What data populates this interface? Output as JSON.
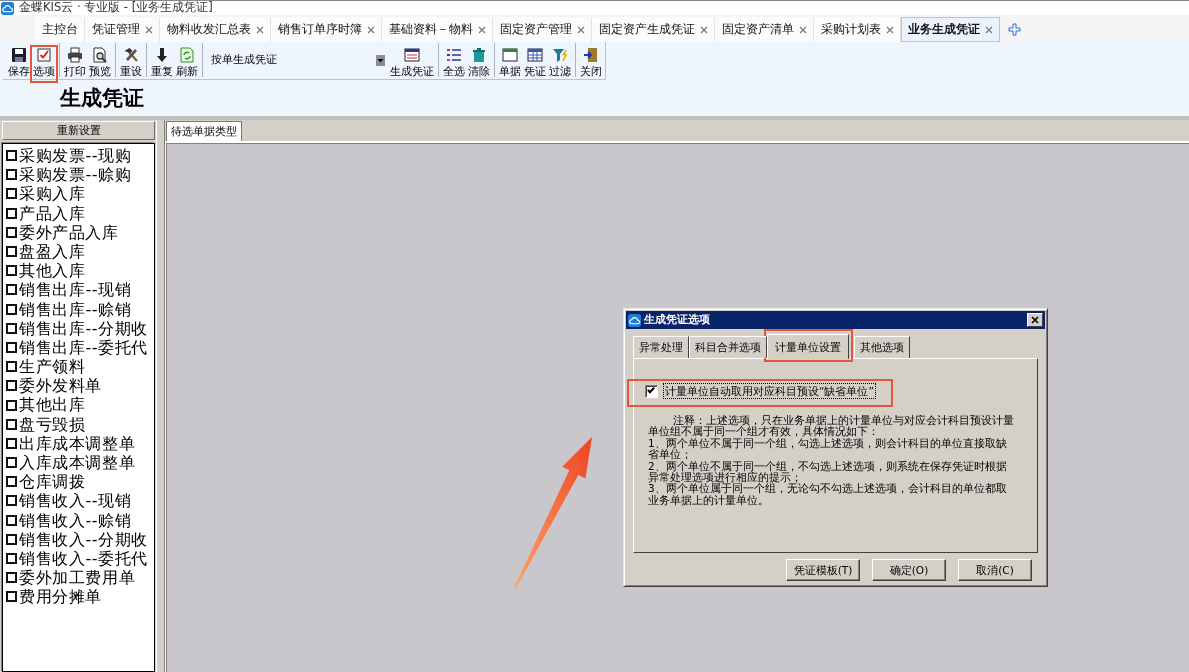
{
  "window": {
    "title": "金蝶KIS云 · 专业版 - [业务生成凭证]"
  },
  "tabs": [
    {
      "label": "主控台",
      "closable": false,
      "selected": false
    },
    {
      "label": "凭证管理",
      "closable": true,
      "selected": false
    },
    {
      "label": "物料收发汇总表",
      "closable": true,
      "selected": false
    },
    {
      "label": "销售订单序时簿",
      "closable": true,
      "selected": false
    },
    {
      "label": "基础资料－物料",
      "closable": true,
      "selected": false
    },
    {
      "label": "固定资产管理",
      "closable": true,
      "selected": false
    },
    {
      "label": "固定资产生成凭证",
      "closable": true,
      "selected": false
    },
    {
      "label": "固定资产清单",
      "closable": true,
      "selected": false
    },
    {
      "label": "采购计划表",
      "closable": true,
      "selected": false
    },
    {
      "label": "业务生成凭证",
      "closable": true,
      "selected": true
    }
  ],
  "toolbar": [
    {
      "kind": "button",
      "label": "保存",
      "highlighted": false
    },
    {
      "kind": "button",
      "label": "选项",
      "highlighted": true
    },
    {
      "kind": "separator"
    },
    {
      "kind": "button",
      "label": "打印",
      "highlighted": false
    },
    {
      "kind": "button",
      "label": "预览",
      "highlighted": false
    },
    {
      "kind": "separator"
    },
    {
      "kind": "button",
      "label": "重设",
      "highlighted": false
    },
    {
      "kind": "separator"
    },
    {
      "kind": "button",
      "label": "重复",
      "highlighted": false
    },
    {
      "kind": "button",
      "label": "刷新",
      "highlighted": false
    },
    {
      "kind": "separator"
    },
    {
      "kind": "dropdown",
      "value": "按单生成凭证"
    },
    {
      "kind": "button",
      "label": "生成凭证",
      "highlighted": false
    },
    {
      "kind": "separator"
    },
    {
      "kind": "button",
      "label": "全选",
      "highlighted": false
    },
    {
      "kind": "button",
      "label": "清除",
      "highlighted": false
    },
    {
      "kind": "separator"
    },
    {
      "kind": "button",
      "label": "单据",
      "highlighted": false
    },
    {
      "kind": "button",
      "label": "凭证",
      "highlighted": false
    },
    {
      "kind": "button",
      "label": "过滤",
      "highlighted": false
    },
    {
      "kind": "separator"
    },
    {
      "kind": "button",
      "label": "关闭",
      "highlighted": false
    }
  ],
  "page_title": "生成凭证",
  "left_panel": {
    "reset_button": "重新设置",
    "document_types": [
      {
        "label": "采购发票--现购",
        "checked": false
      },
      {
        "label": "采购发票--赊购",
        "checked": false
      },
      {
        "label": "采购入库",
        "checked": false
      },
      {
        "label": "产品入库",
        "checked": false
      },
      {
        "label": "委外产品入库",
        "checked": false
      },
      {
        "label": "盘盈入库",
        "checked": false
      },
      {
        "label": "其他入库",
        "checked": false
      },
      {
        "label": "销售出库--现销",
        "checked": false
      },
      {
        "label": "销售出库--赊销",
        "checked": false
      },
      {
        "label": "销售出库--分期收",
        "checked": false
      },
      {
        "label": "销售出库--委托代",
        "checked": false
      },
      {
        "label": "生产领料",
        "checked": false
      },
      {
        "label": "委外发料单",
        "checked": false
      },
      {
        "label": "其他出库",
        "checked": false
      },
      {
        "label": "盘亏毁损",
        "checked": false
      },
      {
        "label": "出库成本调整单",
        "checked": false
      },
      {
        "label": "入库成本调整单",
        "checked": false
      },
      {
        "label": "仓库调拨",
        "checked": false
      },
      {
        "label": "销售收入--现销",
        "checked": false
      },
      {
        "label": "销售收入--赊销",
        "checked": false
      },
      {
        "label": "销售收入--分期收",
        "checked": false
      },
      {
        "label": "销售收入--委托代",
        "checked": false
      },
      {
        "label": "委外加工费用单",
        "checked": false
      },
      {
        "label": "费用分摊单",
        "checked": false
      }
    ]
  },
  "right_panel": {
    "tabs": [
      {
        "label": "待选单据类型",
        "selected": true
      }
    ]
  },
  "dialog": {
    "title": "生成凭证选项",
    "tabs": [
      {
        "label": "异常处理",
        "selected": false,
        "highlighted": false
      },
      {
        "label": "科目合并选项",
        "selected": false,
        "highlighted": false
      },
      {
        "label": "计量单位设置",
        "selected": true,
        "highlighted": true
      },
      {
        "label": "其他选项",
        "selected": false,
        "highlighted": false
      }
    ],
    "option": {
      "label": "计量单位自动取用对应科目预设“缺省单位”",
      "checked": true,
      "highlighted": true
    },
    "note": [
      "注释：上述选项，只在业务单据上的计量单位与对应会计科目预设计量单位组不属于同一个组才有效，具体情况如下：",
      "1、两个单位不属于同一个组，勾选上述选项，则会计科目的单位直接取缺省单位；",
      "2、两个单位不属于同一个组，不勾选上述选项，则系统在保存凭证时根据异常处理选项进行相应的提示；",
      "3、两个单位属于同一个组，无论勾不勾选上述选项，会计科目的单位都取业务单据上的计量单位。"
    ],
    "buttons": [
      "凭证模板(T)",
      "确定(O)",
      "取消(C)"
    ]
  },
  "pointer_arrow": true
}
